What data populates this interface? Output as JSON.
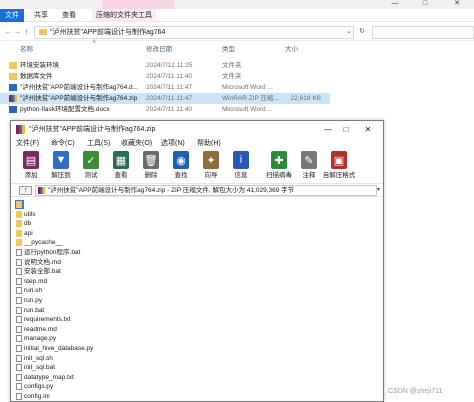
{
  "explorer": {
    "title": "",
    "context_tab": "",
    "ribbon_tabs": [
      "文件",
      "共享",
      "查看",
      "压缩的文件夹工具"
    ],
    "window_buttons": {
      "minimize": "—",
      "maximize": "□",
      "close": "✕"
    },
    "address": "\"泸州扶贫\"APP前端设计与制作ag764",
    "search_placeholder": "",
    "columns": {
      "name": "名称",
      "date": "修改日期",
      "type": "类型",
      "size": "大小"
    },
    "files": [
      {
        "name": "环境安装环境",
        "date": "2024/7/12 11:25",
        "type": "文件夹",
        "size": "",
        "icon": "folder-icon",
        "selected": false
      },
      {
        "name": "数据库文件",
        "date": "2024/7/11 11:40",
        "type": "文件夹",
        "size": "",
        "icon": "folder-icon",
        "selected": false
      },
      {
        "name": "\"泸州扶贫\"APP前端设计与制作ag764.d...",
        "date": "2024/7/11 11:47",
        "type": "Microsoft Word ...",
        "size": "",
        "icon": "word-doc-icon",
        "selected": false
      },
      {
        "name": "\"泸州扶贫\"APP前端设计与制作ag764.zip",
        "date": "2024/7/11 11:47",
        "type": "WinRAR ZIP 压缩...",
        "size": "22,618 KB",
        "icon": "zip-icon",
        "selected": true
      },
      {
        "name": "python-flask环境配置文档.docx",
        "date": "2024/7/11 11:40",
        "type": "Microsoft Word ...",
        "size": "",
        "icon": "word-doc-icon",
        "selected": false
      }
    ]
  },
  "winrar": {
    "title": "\"泸州扶贫\"APP前端设计与制作ag764.zip",
    "window_buttons": {
      "minimize": "—",
      "maximize": "□",
      "close": "✕"
    },
    "menu": [
      "文件(F)",
      "命令(C)",
      "工具(S)",
      "收藏夹(O)",
      "选项(N)",
      "帮助(H)"
    ],
    "toolbar": [
      {
        "label": "添加",
        "icon": "add-icon",
        "color": "#7d2a63",
        "glyph": "▤"
      },
      {
        "label": "解压到",
        "icon": "extract-to-icon",
        "color": "#2f6ec4",
        "glyph": "▼"
      },
      {
        "label": "测试",
        "icon": "test-icon",
        "color": "#3c8a3c",
        "glyph": "✓"
      },
      {
        "label": "查看",
        "icon": "view-icon",
        "color": "#2b6b5a",
        "glyph": "▦"
      },
      {
        "label": "删除",
        "icon": "delete-icon",
        "color": "#6b6b6b",
        "glyph": "🗑"
      },
      {
        "label": "查找",
        "icon": "find-icon",
        "color": "#1f5fb0",
        "glyph": "◉"
      },
      {
        "label": "向导",
        "icon": "wizard-icon",
        "color": "#8a6d3b",
        "glyph": "✦"
      },
      {
        "label": "信息",
        "icon": "info-icon",
        "color": "#2a57b8",
        "glyph": "i"
      },
      {
        "label": "扫描病毒",
        "icon": "scan-virus-icon",
        "color": "#2e8b3a",
        "glyph": "✚"
      },
      {
        "label": "注释",
        "icon": "comment-icon",
        "color": "#777777",
        "glyph": "✎"
      },
      {
        "label": "自解压格式",
        "icon": "sfx-icon",
        "color": "#b0322a",
        "glyph": "▣"
      }
    ],
    "path": "\"泸州扶贫\"APP前端设计与制作ag764.zip - ZIP 压缩文件, 解包大小为 41,029,369 字节",
    "up_label": "↑",
    "entries": [
      {
        "name": "..",
        "kind": "up"
      },
      {
        "name": "utils",
        "kind": "folder"
      },
      {
        "name": "db",
        "kind": "folder"
      },
      {
        "name": "api",
        "kind": "folder"
      },
      {
        "name": "__pycache__",
        "kind": "folder"
      },
      {
        "name": "运行python程序.bat",
        "kind": "file"
      },
      {
        "name": "说明文档.md",
        "kind": "file"
      },
      {
        "name": "安装全部.bat",
        "kind": "file"
      },
      {
        "name": "step.md",
        "kind": "file"
      },
      {
        "name": "run.sh",
        "kind": "file"
      },
      {
        "name": "run.py",
        "kind": "file"
      },
      {
        "name": "run.bat",
        "kind": "file"
      },
      {
        "name": "requirements.txt",
        "kind": "file"
      },
      {
        "name": "readme.md",
        "kind": "file"
      },
      {
        "name": "manage.py",
        "kind": "file"
      },
      {
        "name": "initial_hive_database.py",
        "kind": "file"
      },
      {
        "name": "init_sql.sh",
        "kind": "file"
      },
      {
        "name": "init_sql.bat",
        "kind": "file"
      },
      {
        "name": "datatype_map.txt",
        "kind": "file"
      },
      {
        "name": "configs.py",
        "kind": "file"
      },
      {
        "name": "config.ini",
        "kind": "file"
      }
    ]
  },
  "watermark": "CSDN @sheji711"
}
